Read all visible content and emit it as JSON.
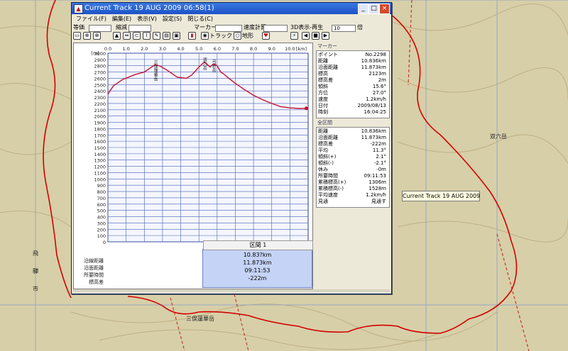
{
  "window": {
    "title": "Current Track 19 AUG 2009 06:58(1)",
    "menu": [
      "ファイル(F)",
      "編集(E)",
      "表示(V)",
      "設定(S)",
      "閉じる(C)"
    ],
    "toolbar": {
      "label_a": "等価",
      "label_b": "縮減",
      "label_marker": "マーカー",
      "label_speed": "速度計算",
      "label_3d": "3D表示-再生",
      "radio_track": "トラック",
      "radio_terrain": "地形",
      "select_value": "10",
      "select_unit": "倍"
    }
  },
  "chart": {
    "x_ticks": [
      "0.0",
      "1.0",
      "2.0",
      "3.0",
      "4.0",
      "5.0",
      "6.0",
      "7.0",
      "8.0",
      "9.0",
      "10.0"
    ],
    "x_unit": "[km]",
    "y_unit": "[m]",
    "y_ticks": [
      "3000",
      "2900",
      "2800",
      "2700",
      "2600",
      "2500",
      "2400",
      "2300",
      "2200",
      "2100",
      "2000",
      "1900",
      "1800",
      "1700",
      "1600",
      "1500",
      "1400",
      "1300",
      "1200",
      "1100",
      "1000",
      "900",
      "800",
      "700",
      "600",
      "500",
      "400",
      "300",
      "200",
      "100",
      "0"
    ],
    "peak_labels": [
      "三俣蓮華岳",
      "双六岳",
      "弓折岳"
    ],
    "row_labels": [
      "沿線距離",
      "沿面距離",
      "所要時間",
      "標高差"
    ],
    "line_color": "#c8102e"
  },
  "chart_data": {
    "type": "line",
    "xlim": [
      0,
      11
    ],
    "ylim": [
      0,
      3000
    ],
    "x": [
      0,
      0.3,
      0.8,
      1.5,
      2.0,
      2.6,
      2.9,
      3.3,
      3.8,
      4.3,
      4.6,
      5.0,
      5.3,
      5.5,
      5.6,
      5.8,
      6.0,
      6.2,
      6.4,
      6.6,
      7.0,
      7.5,
      8.0,
      8.5,
      9.0,
      9.5,
      10.0,
      10.5,
      10.9
    ],
    "y": [
      2350,
      2480,
      2580,
      2660,
      2700,
      2820,
      2790,
      2720,
      2620,
      2600,
      2650,
      2780,
      2860,
      2810,
      2780,
      2830,
      2800,
      2700,
      2660,
      2610,
      2520,
      2420,
      2330,
      2260,
      2200,
      2150,
      2130,
      2120,
      2123
    ]
  },
  "summary": {
    "title": "区間 1",
    "values": [
      "10.83?km",
      "11.873km",
      "09:11:53",
      "-222m"
    ]
  },
  "marker_panel": {
    "title": "マーカー",
    "rows": [
      {
        "label": "ポイント",
        "value": "No.2298"
      },
      {
        "label": "距離",
        "value": "10.836km"
      },
      {
        "label": "沿面距離",
        "value": "11.873km"
      },
      {
        "label": "標高",
        "value": "2123m"
      },
      {
        "label": "標高差",
        "value": "2m"
      },
      {
        "label": "傾斜",
        "value": "15.6°"
      },
      {
        "label": "方位",
        "value": "27.0°"
      },
      {
        "label": "速度",
        "value": "1.2km/h"
      },
      {
        "label": "日付",
        "value": "2009/08/13"
      },
      {
        "label": "時刻",
        "value": "16:04:25"
      }
    ]
  },
  "section_panel": {
    "title": "全区間",
    "rows": [
      {
        "label": "距離",
        "value": "10.836km"
      },
      {
        "label": "沿面距離",
        "value": "11.873km"
      },
      {
        "label": "標高差",
        "value": "-222m"
      },
      {
        "label": "平均",
        "value": "11.3°"
      },
      {
        "label": "傾斜(+)",
        "value": "2.1°"
      },
      {
        "label": "傾斜(-)",
        "value": "-2.1°"
      },
      {
        "label": "休み",
        "value": "-0m"
      },
      {
        "label": "所要時間",
        "value": "09:11:53"
      },
      {
        "label": "累積標高(+)",
        "value": "1306m"
      },
      {
        "label": "累積標高(-)",
        "value": "1528m"
      },
      {
        "label": "平均速度",
        "value": "1.2km/h"
      },
      {
        "label": "見通",
        "value": "見通す"
      }
    ]
  },
  "tooltip": "Current Track 19 AUG 2009",
  "map_labels": [
    "飛",
    "驒",
    "市",
    "双六岳",
    "三俣蓮華岳"
  ],
  "map_track_color": "#d40000"
}
